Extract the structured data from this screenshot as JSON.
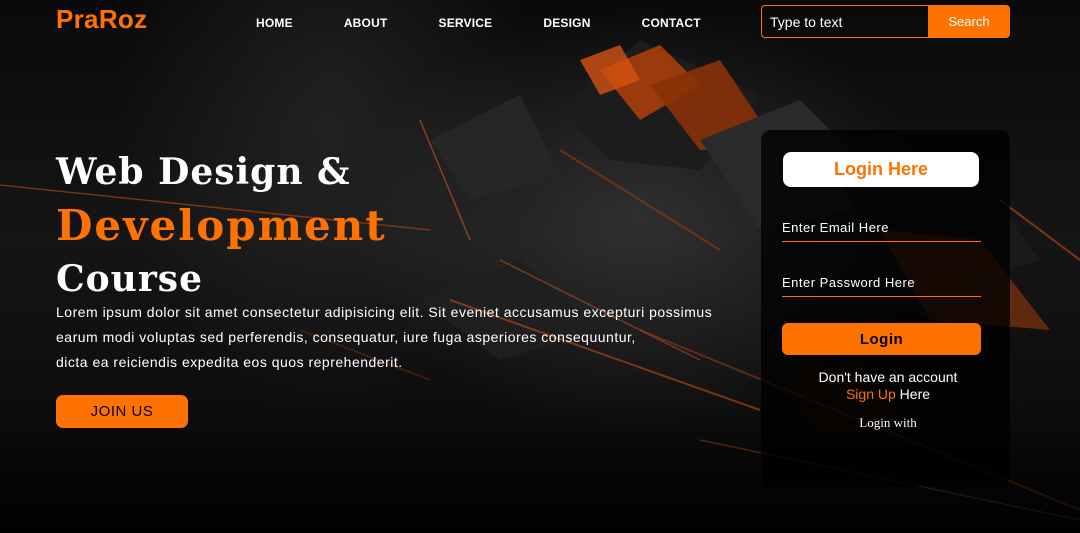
{
  "brand": {
    "logo": "PraRoz",
    "accent": "#ff7200"
  },
  "nav": {
    "items": [
      "HOME",
      "ABOUT",
      "SERVICE",
      "DESIGN",
      "CONTACT"
    ]
  },
  "search": {
    "placeholder": "Type to text",
    "button_label": "Search"
  },
  "hero": {
    "title_line1": "Web Design &",
    "title_line2": "Development",
    "title_line3": "Course",
    "paragraph_lines": [
      "Lorem ipsum dolor sit amet consectetur adipisicing elit. Sit eveniet accusamus excepturi possimus",
      "earum modi voluptas sed perferendis, consequatur, iure fuga asperiores consequuntur,",
      "dicta ea reiciendis expedita eos quos reprehenderit."
    ],
    "join_label": "JOIN US"
  },
  "login": {
    "title": "Login Here",
    "email_placeholder": "Enter Email Here",
    "password_placeholder": "Enter Password Here",
    "button_label": "Login",
    "no_account_text": "Don't have an account",
    "signup_link": "Sign Up",
    "signup_suffix": " Here",
    "login_with": "Login with"
  }
}
